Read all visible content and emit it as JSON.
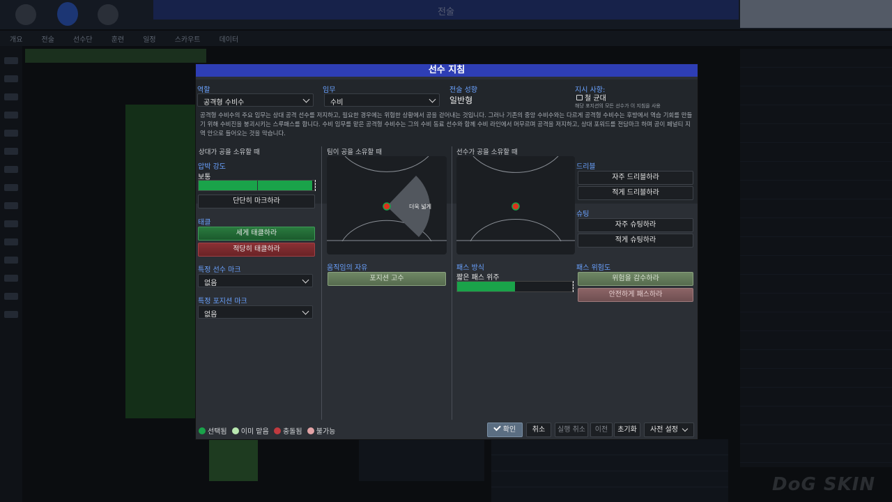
{
  "background": {
    "window_title": "전술",
    "nav_items": [
      "개요",
      "전술",
      "선수단",
      "훈련",
      "일정",
      "스카우트",
      "데이터"
    ],
    "watermark": "DoG SKIN"
  },
  "dialog": {
    "title": "선수 지침",
    "role": {
      "label": "역할",
      "value": "공격형 수비수"
    },
    "duty": {
      "label": "임무",
      "value": "수비"
    },
    "tactical_tendency": {
      "label": "전술 성향",
      "value": "일반형"
    },
    "instructions": {
      "label": "지시 사항:",
      "value": "철 균대",
      "note": "해당 포지션의 모든 선수가 이 지침을 사용"
    },
    "description": "공격형 수비수의 주요 임무는 상대 공격 선수를 저지하고, 필요한 경우에는 위험한 상황에서 공을 걷어내는 것입니다. 그러나 기존의 중앙 수비수와는 다르게 공격형 수비수는 후방에서 역습 기회를 만들기 위해 수비진을 붕괴시키는 스루패스를 합니다. 수비 임무를 맡은 공격형 수비수는 그의 수비 동료 선수와 함께 수비 라인에서 머무르며 공격을 저지하고, 상대 포워드를 전담마크 하며 공이 페널티 지역 안으로 들어오는 것을 막습니다.",
    "opp_possession": {
      "title": "상대가 공을 소유할 때",
      "pressing": {
        "label": "압박 강도",
        "value": "보통",
        "level": 0.98
      },
      "mark_tightly": "단단히 마크하라",
      "tackling": {
        "label": "태클",
        "hard": "세게 태클하라",
        "moderate": "적당히 태클하라"
      },
      "player_mark": {
        "label": "특정 선수 마크",
        "value": "없음"
      },
      "position_mark": {
        "label": "특정 포지션 마크",
        "value": "없음"
      }
    },
    "team_possession": {
      "title": "팀이 공을 소유할 때",
      "zone_label": "더욱 넓게",
      "freedom": {
        "label": "움직임의 자유",
        "value": "포지션 고수"
      }
    },
    "player_possession": {
      "title": "선수가 공을 소유할 때",
      "dribbling": {
        "label": "드리블",
        "more": "자주 드리블하라",
        "less": "적게 드리블하라"
      },
      "shooting": {
        "label": "슈팅",
        "more": "자주 슈팅하라",
        "less": "적게 슈팅하라"
      },
      "passing_style": {
        "label": "패스 방식",
        "value": "짧은 패스 위주",
        "level": 0.5
      },
      "pass_risk": {
        "label": "패스 위험도",
        "reduce": "위험을 감수하라",
        "safe": "안전하게 패스하라"
      }
    },
    "legend": {
      "selected": "선택됨",
      "already": "이미 맡음",
      "conflict": "충돌됨",
      "unavailable": "불가능"
    },
    "footer": {
      "confirm": "확인",
      "cancel": "취소",
      "undo": "실행 취소",
      "previous": "이전",
      "reset": "초기화",
      "presets": "사전 설정"
    },
    "colors": {
      "title_bar": "#2e3eb5",
      "selected": "#1aa34a",
      "already": "#b9e8b0",
      "conflict": "#c03a3f",
      "unavailable": "#e3a3a6"
    }
  }
}
